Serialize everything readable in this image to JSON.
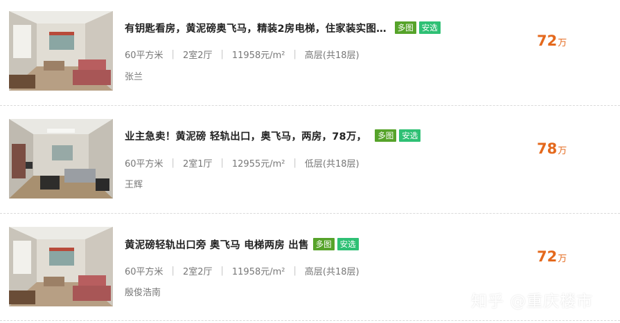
{
  "listings": [
    {
      "title": "有钥匙看房，黄泥磅奥飞马，精装2房电梯，住家装实图…",
      "tags": [
        "多图",
        "安选"
      ],
      "meta": [
        "60平方米",
        "2室2厅",
        "11958元/m²",
        "高层(共18层)"
      ],
      "agent": "张兰",
      "price": "72",
      "unit": "万"
    },
    {
      "title": "业主急卖！黄泥磅 轻轨出口，奥飞马，两房，78万，",
      "tags": [
        "多图",
        "安选"
      ],
      "meta": [
        "60平方米",
        "2室1厅",
        "12955元/m²",
        "低层(共18层)"
      ],
      "agent": "王辉",
      "price": "78",
      "unit": "万"
    },
    {
      "title": "黄泥磅轻轨出口旁 奥飞马 电梯两房 出售",
      "tags": [
        "多图",
        "安选"
      ],
      "meta": [
        "60平方米",
        "2室2厅",
        "11958元/m²",
        "高层(共18层)"
      ],
      "agent": "殷俊浩南",
      "price": "72",
      "unit": "万"
    }
  ],
  "watermark": "知乎 @重庆楼市",
  "colors": {
    "price": "#e4691d",
    "tag_more": "#56a32a",
    "tag_safe": "#2ec074"
  }
}
